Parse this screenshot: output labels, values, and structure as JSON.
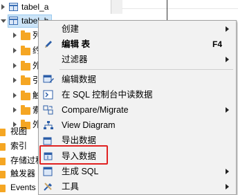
{
  "tree": {
    "items": [
      {
        "label": "tabel_a"
      },
      {
        "label": "tabel_b"
      },
      {
        "label": "列"
      },
      {
        "label": "约"
      },
      {
        "label": "外"
      },
      {
        "label": "引"
      },
      {
        "label": "触"
      },
      {
        "label": "索"
      },
      {
        "label": "外"
      }
    ],
    "folders": [
      {
        "label": "视图"
      },
      {
        "label": "索引"
      },
      {
        "label": "存储过程"
      },
      {
        "label": "触发器"
      },
      {
        "label": "Events"
      }
    ]
  },
  "menu": {
    "items": [
      {
        "label": "创建",
        "submenu": true
      },
      {
        "label": "编辑 表",
        "shortcut": "F4",
        "bold": true
      },
      {
        "label": "过滤器",
        "submenu": true
      },
      {
        "label": "编辑数据"
      },
      {
        "label": "在 SQL 控制台中读数据"
      },
      {
        "label": "Compare/Migrate",
        "submenu": true
      },
      {
        "label": "View Diagram"
      },
      {
        "label": "导出数据"
      },
      {
        "label": "导入数据"
      },
      {
        "label": "生成 SQL",
        "submenu": true
      },
      {
        "label": "工具",
        "submenu": true
      }
    ]
  },
  "colors": {
    "highlight_border": "#e02020",
    "menu_bg": "#f2f2f2",
    "selection": "#cce4f7"
  }
}
